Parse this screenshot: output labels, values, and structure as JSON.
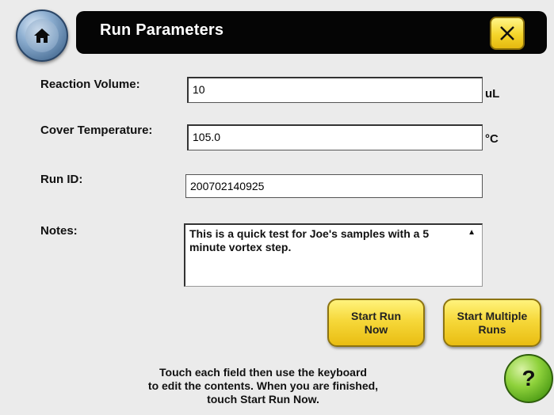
{
  "header": {
    "title": "Run Parameters"
  },
  "fields": {
    "reaction_volume": {
      "label": "Reaction Volume:",
      "value": "10",
      "unit": "uL"
    },
    "cover_temperature": {
      "label": "Cover Temperature:",
      "value": "105.0",
      "unit": "°C"
    },
    "run_id": {
      "label": "Run ID:",
      "value": "200702140925"
    },
    "notes": {
      "label": "Notes:",
      "value": "This is a quick test for Joe's samples with a 5 minute vortex step."
    }
  },
  "buttons": {
    "start_run_now": "Start Run\nNow",
    "start_multiple_runs": "Start Multiple\nRuns",
    "help": "?"
  },
  "instructions": "Touch each field then use the keyboard\nto edit the contents. When you are finished,\ntouch Start Run Now.",
  "icons": {
    "home": "home-icon",
    "close": "close-icon",
    "help": "help-icon"
  },
  "colors": {
    "accent_yellow": "#f6d83a",
    "titlebar": "#050505",
    "help_green": "#8fd23c"
  }
}
